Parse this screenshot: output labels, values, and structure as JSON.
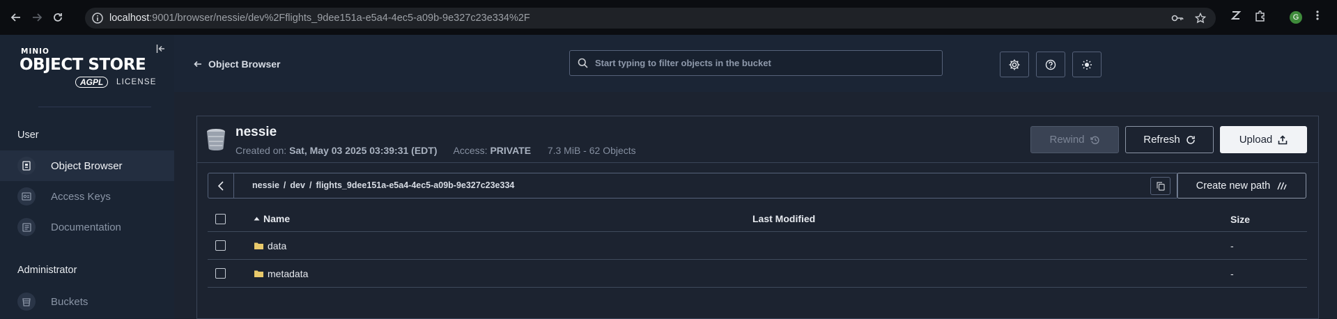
{
  "browser": {
    "url_host": "localhost",
    "url_rest": ":9001/browser/nessie/dev%2Fflights_9dee151a-e5a4-4ec5-a09b-9e327c23e334%2F",
    "profile_initial": "G"
  },
  "sidebar": {
    "logo_minio": "MINIO",
    "logo_title": "OBJECT STORE",
    "logo_badge": "AGPL",
    "logo_license": "LICENSE",
    "sections": [
      {
        "title": "User",
        "items": [
          {
            "label": "Object Browser",
            "icon": "object-browser-icon",
            "active": true
          },
          {
            "label": "Access Keys",
            "icon": "access-keys-icon",
            "active": false
          },
          {
            "label": "Documentation",
            "icon": "documentation-icon",
            "active": false
          }
        ]
      },
      {
        "title": "Administrator",
        "items": [
          {
            "label": "Buckets",
            "icon": "buckets-icon",
            "active": false
          }
        ]
      }
    ]
  },
  "topbar": {
    "back_label": "Object Browser",
    "search_placeholder": "Start typing to filter objects in the bucket",
    "search_value": ""
  },
  "bucket": {
    "name": "nessie",
    "created_label": "Created on:",
    "created_value": "Sat, May 03 2025 03:39:31 (EDT)",
    "access_label": "Access:",
    "access_value": "PRIVATE",
    "stats": "7.3 MiB - 62 Objects"
  },
  "actions": {
    "rewind": "Rewind",
    "refresh": "Refresh",
    "upload": "Upload"
  },
  "path": {
    "crumbs": [
      "nessie",
      "dev",
      "flights_9dee151a-e5a4-4ec5-a09b-9e327c23e334"
    ],
    "separator": "/",
    "create_new_path": "Create new path"
  },
  "table": {
    "columns": {
      "name": "Name",
      "modified": "Last Modified",
      "size": "Size"
    },
    "rows": [
      {
        "name": "data",
        "modified": "",
        "size": "-"
      },
      {
        "name": "metadata",
        "modified": "",
        "size": "-"
      }
    ]
  },
  "colors": {
    "accent_red": "#c72c48",
    "sidebar_bg": "#1a2433",
    "main_bg": "#1c2330",
    "folder": "#e8c96b"
  }
}
